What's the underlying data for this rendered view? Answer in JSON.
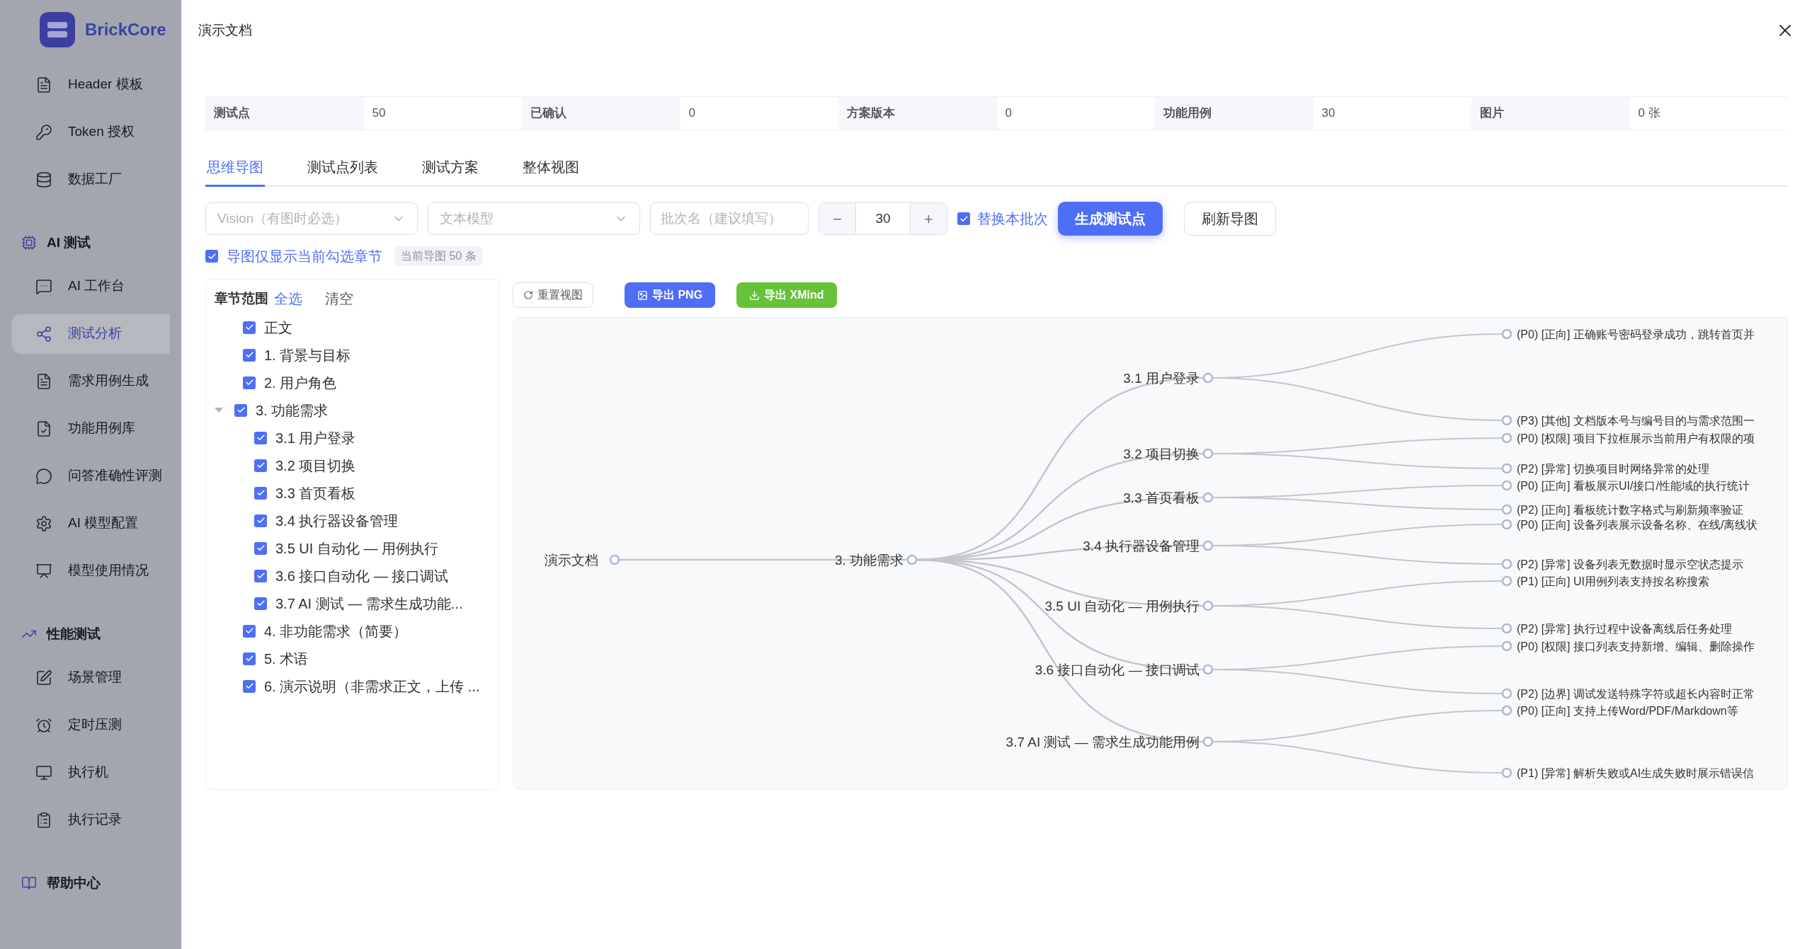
{
  "sidebar": {
    "brand": "BrickCore",
    "sections": [
      {
        "kind": "plain",
        "items": [
          {
            "label": "Header 模板",
            "selected": false
          },
          {
            "label": "Token 授权",
            "selected": false
          },
          {
            "label": "数据工厂",
            "selected": false
          }
        ]
      },
      {
        "kind": "group",
        "title": "AI 测试",
        "items": [
          {
            "label": "AI 工作台",
            "selected": false
          },
          {
            "label": "测试分析",
            "selected": true
          },
          {
            "label": "需求用例生成",
            "selected": false
          },
          {
            "label": "功能用例库",
            "selected": false
          },
          {
            "label": "问答准确性评测",
            "selected": false
          },
          {
            "label": "AI 模型配置",
            "selected": false
          },
          {
            "label": "模型使用情况",
            "selected": false
          }
        ]
      },
      {
        "kind": "group",
        "title": "性能测试",
        "items": [
          {
            "label": "场景管理",
            "selected": false
          },
          {
            "label": "定时压测",
            "selected": false
          },
          {
            "label": "执行机",
            "selected": false
          },
          {
            "label": "执行记录",
            "selected": false
          }
        ]
      },
      {
        "kind": "group",
        "title": "帮助中心"
      }
    ]
  },
  "drawer": {
    "title": "演示文档"
  },
  "stats": [
    {
      "label": "测试点",
      "value": "50"
    },
    {
      "label": "已确认",
      "value": "0"
    },
    {
      "label": "方案版本",
      "value": "0"
    },
    {
      "label": "功能用例",
      "value": "30"
    },
    {
      "label": "图片",
      "value": "0 张"
    }
  ],
  "tabs": [
    {
      "label": "思维导图",
      "selected": true
    },
    {
      "label": "测试点列表",
      "selected": false
    },
    {
      "label": "测试方案",
      "selected": false
    },
    {
      "label": "整体视图",
      "selected": false
    }
  ],
  "toolbar": {
    "vision_select": {
      "placeholder": "Vision（有图时必选）"
    },
    "model_select": {
      "placeholder": "文本模型"
    },
    "batch_input": {
      "placeholder": "批次名（建议填写）"
    },
    "stepper": {
      "minus": "−",
      "value": "30",
      "plus": "+"
    },
    "replace_batch": {
      "label": "替换本批次",
      "checked": true
    },
    "generate": "生成测试点",
    "refresh": "刷新导图"
  },
  "filter": {
    "label": "导图仅显示当前勾选章节",
    "checked": true,
    "tag": "当前导图 50 条"
  },
  "chapters": {
    "title": "章节范围",
    "select_all": "全选",
    "clear": "清空",
    "items": [
      {
        "label": "正文",
        "checked": true
      },
      {
        "label": "1. 背景与目标",
        "checked": true
      },
      {
        "label": "2. 用户角色",
        "checked": true
      },
      {
        "label": "3. 功能需求",
        "checked": true,
        "expanded": true,
        "children": [
          {
            "label": "3.1 用户登录",
            "checked": true
          },
          {
            "label": "3.2 项目切换",
            "checked": true
          },
          {
            "label": "3.3 首页看板",
            "checked": true
          },
          {
            "label": "3.4 执行器设备管理",
            "checked": true
          },
          {
            "label": "3.5 UI 自动化 — 用例执行",
            "checked": true
          },
          {
            "label": "3.6 接口自动化 — 接口调试",
            "checked": true
          },
          {
            "label": "3.7 AI 测试 — 需求生成功能...",
            "checked": true
          }
        ]
      },
      {
        "label": "4. 非功能需求（简要）",
        "checked": true
      },
      {
        "label": "5. 术语",
        "checked": true
      },
      {
        "label": "6. 演示说明（非需求正文，上传 ...",
        "checked": true
      }
    ]
  },
  "mindmap_toolbar": {
    "reset": "重置视图",
    "export_png": "导出 PNG",
    "export_xmind": "导出 XMind"
  },
  "mindmap": {
    "root": "演示文档",
    "node": "3. 功能需求",
    "branches": [
      {
        "label": "3.1 用户登录",
        "leaves": [
          "(P0) [正向] 正确账号密码登录成功，跳转首页并",
          "(P3) [其他] 文档版本号与编号目的与需求范围一"
        ]
      },
      {
        "label": "3.2 项目切换",
        "leaves": [
          "(P0) [权限] 项目下拉框展示当前用户有权限的项",
          "(P2) [异常] 切换项目时网络异常的处理"
        ]
      },
      {
        "label": "3.3 首页看板",
        "leaves": [
          "(P0) [正向] 看板展示UI/接口/性能域的执行统计",
          "(P2) [正向] 看板统计数字格式与刷新频率验证"
        ]
      },
      {
        "label": "3.4 执行器设备管理",
        "leaves": [
          "(P0) [正向] 设备列表展示设备名称、在线/离线状",
          "(P2) [异常] 设备列表无数据时显示空状态提示"
        ]
      },
      {
        "label": "3.5 UI 自动化 — 用例执行",
        "leaves": [
          "(P1) [正向] UI用例列表支持按名称搜索",
          "(P2) [异常] 执行过程中设备离线后任务处理"
        ]
      },
      {
        "label": "3.6 接口自动化 — 接口调试",
        "leaves": [
          "(P0) [权限] 接口列表支持新增、编辑、删除操作",
          "(P2) [边界] 调试发送特殊字符或超长内容时正常"
        ]
      },
      {
        "label": "3.7 AI 测试 — 需求生成功能用例",
        "leaves": [
          "(P0) [正向] 支持上传Word/PDF/Markdown等",
          "(P1) [异常] 解析失败或AI生成失败时展示错误信"
        ]
      }
    ]
  }
}
